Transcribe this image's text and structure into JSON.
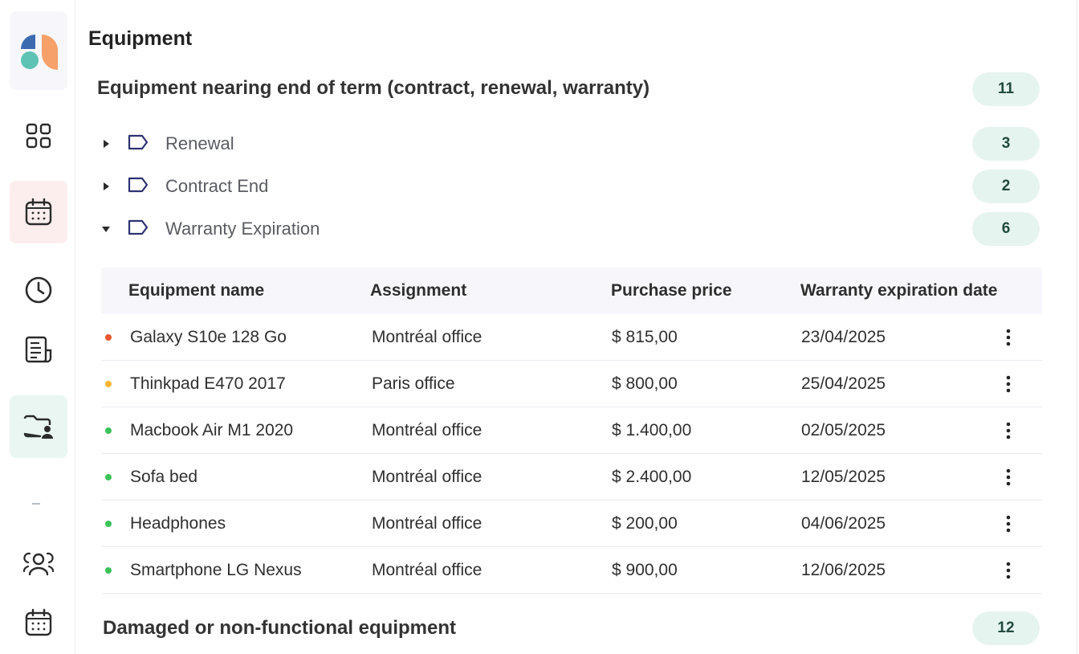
{
  "app": {
    "logo": "app-logo",
    "colors": {
      "accent_green": "#e6f4ef",
      "accent_red": "#fdeeee",
      "dot_red": "#e8552f",
      "dot_orange": "#f5b433",
      "dot_green": "#3cc25a"
    }
  },
  "sidebar": {
    "items": [
      {
        "icon": "dashboard-grid-icon",
        "active": false
      },
      {
        "icon": "calendar-icon",
        "active": true
      },
      {
        "icon": "clock-icon",
        "active": false
      },
      {
        "icon": "document-list-icon",
        "active": false
      },
      {
        "icon": "folder-user-icon",
        "active": true
      },
      {
        "icon": "team-icon",
        "active": false
      },
      {
        "icon": "calendar-icon",
        "active": false
      }
    ]
  },
  "page": {
    "title": "Equipment"
  },
  "sections": {
    "end_of_term": {
      "title": "Equipment nearing end of term (contract, renewal, warranty)",
      "count": "11",
      "categories": [
        {
          "label": "Renewal",
          "count": "3",
          "expanded": false
        },
        {
          "label": "Contract End",
          "count": "2",
          "expanded": false
        },
        {
          "label": "Warranty Expiration",
          "count": "6",
          "expanded": true
        }
      ]
    },
    "damaged": {
      "title": "Damaged or non-functional equipment",
      "count": "12"
    }
  },
  "table": {
    "columns": [
      "Equipment name",
      "Assignment",
      "Purchase price",
      "Warranty expiration date"
    ],
    "rows": [
      {
        "status": "red",
        "name": "Galaxy S10e 128 Go",
        "assignment": "Montréal office",
        "price": "$ 815,00",
        "date": "23/04/2025"
      },
      {
        "status": "orange",
        "name": "Thinkpad E470 2017",
        "assignment": "Paris office",
        "price": "$ 800,00",
        "date": "25/04/2025"
      },
      {
        "status": "green",
        "name": "Macbook Air M1 2020",
        "assignment": "Montréal office",
        "price": "$ 1.400,00",
        "date": "02/05/2025"
      },
      {
        "status": "green",
        "name": "Sofa bed",
        "assignment": "Montréal office",
        "price": "$ 2.400,00",
        "date": "12/05/2025"
      },
      {
        "status": "green",
        "name": "Headphones",
        "assignment": "Montréal office",
        "price": "$ 200,00",
        "date": "04/06/2025"
      },
      {
        "status": "green",
        "name": "Smartphone LG Nexus",
        "assignment": "Montréal office",
        "price": "$ 900,00",
        "date": "12/06/2025"
      }
    ]
  }
}
